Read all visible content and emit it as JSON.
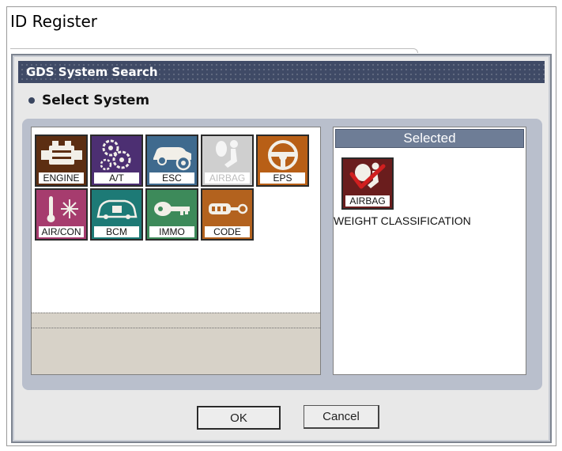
{
  "page": {
    "title": "ID Register"
  },
  "dialog": {
    "title": "GDS System Search",
    "section_label": "Select System",
    "systems": [
      {
        "label": "ENGINE",
        "icon": "engine-icon",
        "color": "#5c2e12",
        "enabled": true
      },
      {
        "label": "A/T",
        "icon": "gears-icon",
        "color": "#4c2f72",
        "enabled": true
      },
      {
        "label": "ESC",
        "icon": "car-brake-icon",
        "color": "#3f6a8e",
        "enabled": true
      },
      {
        "label": "AIRBAG",
        "icon": "airbag-icon",
        "color": "#cfcfcf",
        "enabled": false
      },
      {
        "label": "EPS",
        "icon": "steering-wheel-icon",
        "color": "#b85f16",
        "enabled": true
      },
      {
        "label": "AIR/CON",
        "icon": "aircon-icon",
        "color": "#a63c6e",
        "enabled": true
      },
      {
        "label": "BCM",
        "icon": "bcm-car-icon",
        "color": "#1d7a76",
        "enabled": true
      },
      {
        "label": "IMMO",
        "icon": "key-icon",
        "color": "#3d8a5a",
        "enabled": true
      },
      {
        "label": "CODE",
        "icon": "code-key-icon",
        "color": "#b3621e",
        "enabled": true
      }
    ],
    "selected": {
      "header": "Selected",
      "item_label": "AIRBAG",
      "item_icon": "airbag-check-icon",
      "item_color": "#6a1d1d",
      "description": "WEIGHT CLASSIFICATION"
    },
    "buttons": {
      "ok": "OK",
      "cancel": "Cancel"
    }
  }
}
